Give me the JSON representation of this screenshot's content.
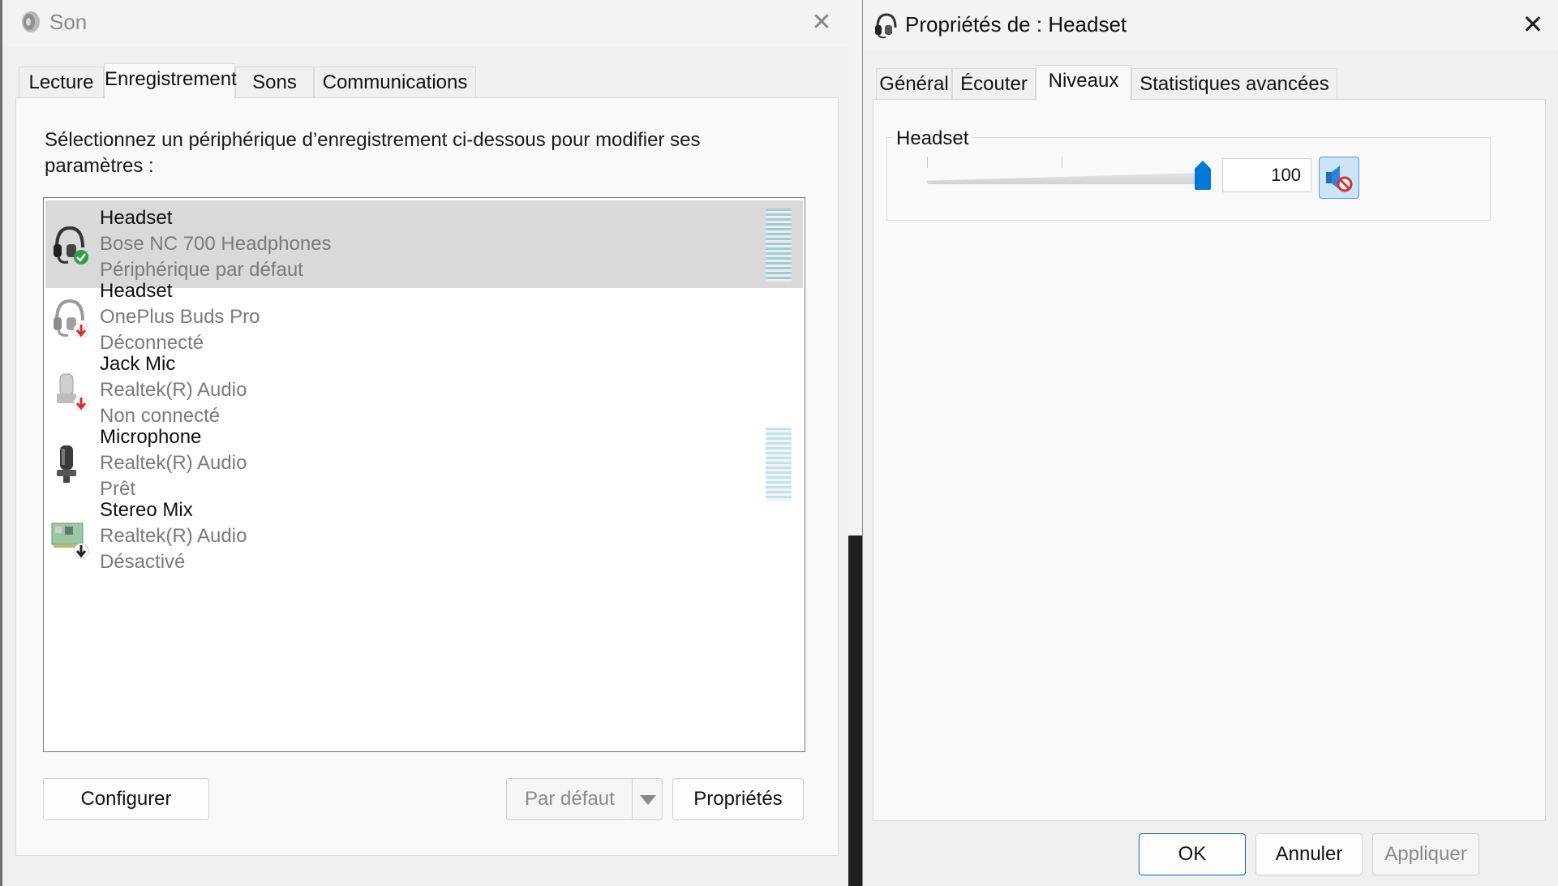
{
  "sound_window": {
    "title": "Son",
    "tabs": [
      {
        "label": "Lecture"
      },
      {
        "label": "Enregistrement"
      },
      {
        "label": "Sons"
      },
      {
        "label": "Communications"
      }
    ],
    "active_tab": "Enregistrement",
    "instruction": "Sélectionnez un périphérique d’enregistrement ci-dessous pour modifier ses paramètres :",
    "devices": [
      {
        "name": "Headset",
        "subtitle": "Bose NC 700 Headphones",
        "status": "Périphérique par défaut",
        "icon": "headset-default-icon",
        "selected": true
      },
      {
        "name": "Headset",
        "subtitle": "OnePlus Buds Pro",
        "status": "Déconnecté",
        "icon": "headset-disconnected-icon"
      },
      {
        "name": "Jack Mic",
        "subtitle": "Realtek(R) Audio",
        "status": "Non connecté",
        "icon": "jack-mic-icon"
      },
      {
        "name": "Microphone",
        "subtitle": "Realtek(R) Audio",
        "status": "Prêt",
        "icon": "microphone-icon"
      },
      {
        "name": "Stereo Mix",
        "subtitle": "Realtek(R) Audio",
        "status": "Désactivé",
        "icon": "sound-card-icon"
      }
    ],
    "buttons": {
      "configure": "Configurer",
      "set_default": "Par défaut",
      "properties": "Propriétés"
    }
  },
  "properties_window": {
    "title": "Propriétés de : Headset",
    "tabs": [
      {
        "label": "Général"
      },
      {
        "label": "Écouter"
      },
      {
        "label": "Niveaux"
      },
      {
        "label": "Statistiques avancées"
      }
    ],
    "active_tab": "Niveaux",
    "levels": {
      "group_label": "Headset",
      "volume_value": "100",
      "slider_fraction": 1.0
    },
    "buttons": {
      "ok": "OK",
      "cancel": "Annuler",
      "apply": "Appliquer"
    }
  },
  "colors": {
    "accent": "#0078d4",
    "selected_row": "#d9d9d9",
    "default_badge": "#2ea043",
    "disconnected_badge": "#d32f2f"
  }
}
